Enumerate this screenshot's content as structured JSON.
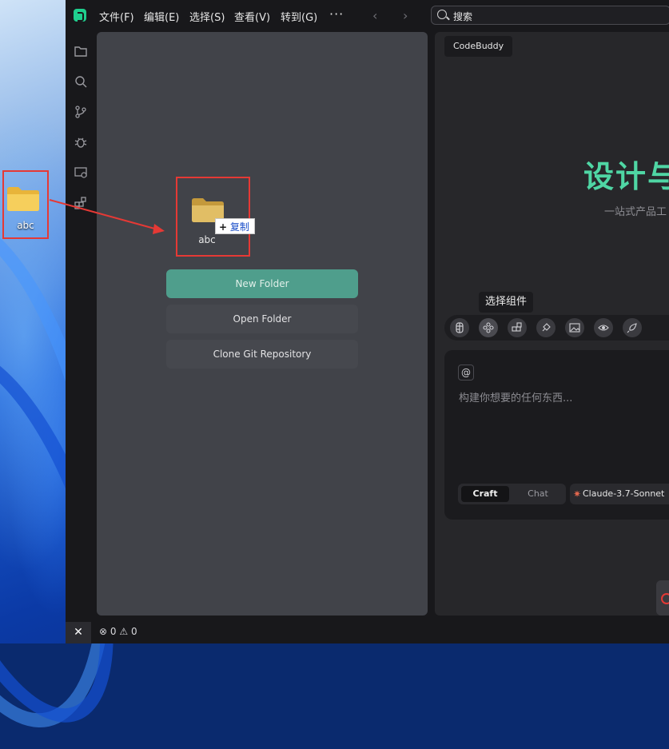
{
  "desktop": {
    "icon_label": "abc"
  },
  "titlebar": {
    "menu": [
      {
        "label": "文件(F)"
      },
      {
        "label": "编辑(E)"
      },
      {
        "label": "选择(S)"
      },
      {
        "label": "查看(V)"
      },
      {
        "label": "转到(G)"
      }
    ],
    "more_label": "···",
    "search_placeholder": "搜索"
  },
  "explorer": {
    "dragged_item_label": "abc",
    "drag_tooltip": "复制",
    "buttons": {
      "new_folder": "New Folder",
      "open_folder": "Open Folder",
      "clone_repo": "Clone Git Repository"
    }
  },
  "chat_panel": {
    "tab_label": "CodeBuddy",
    "hero_title": "设计与",
    "hero_subtitle": "一站式产品工",
    "tooltip": "选择组件",
    "input_placeholder": "构建你想要的任何东西...",
    "at_symbol": "@",
    "modes": [
      "Craft",
      "Chat"
    ],
    "active_mode": "Craft",
    "model_label": "Claude-3.7-Sonnet"
  },
  "statusbar": {
    "errors": "0",
    "warnings": "0"
  },
  "colors": {
    "accent": "#4fd6a4",
    "primary_button": "#4f9e8c",
    "highlight_box": "#e53935"
  }
}
